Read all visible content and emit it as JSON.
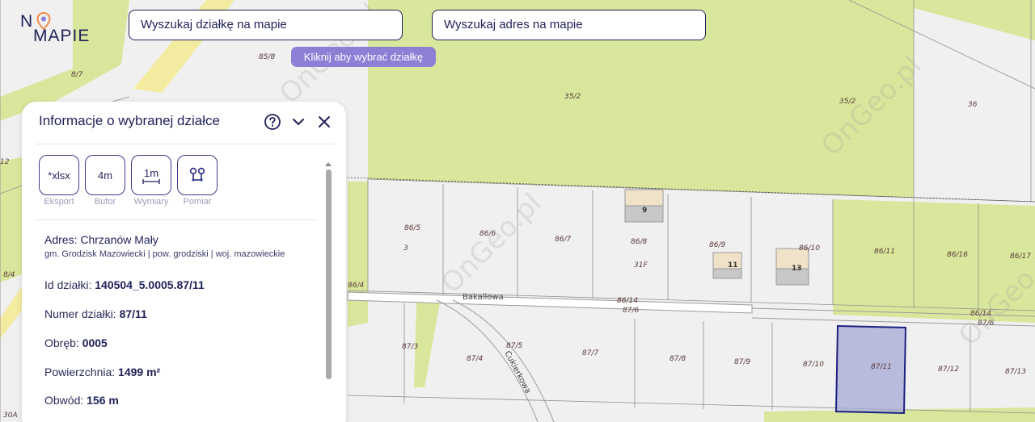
{
  "logo": {
    "line1": "N",
    "line1b": "",
    "line2": "MAPIE"
  },
  "search": {
    "parcel_label": "Wyszukaj działkę na mapie",
    "address_label": "Wyszukaj adres na mapie"
  },
  "tooltip": "Kliknij aby wybrać działkę",
  "panel": {
    "title": "Informacje o wybranej działce",
    "tools": [
      {
        "text": "*xlsx",
        "label": "Eksport"
      },
      {
        "text": "4m",
        "label": "Bufor"
      },
      {
        "text": "1m",
        "label": "Wymiary"
      },
      {
        "text": "",
        "label": "Pomiar"
      }
    ],
    "address": "Adres: Chrzanów Mały",
    "address_sub": "gm. Grodzisk Mazowiecki | pow. grodziski | woj. mazowieckie",
    "rows": [
      {
        "label": "Id działki: ",
        "value": "140504_5.0005.87/11"
      },
      {
        "label": "Numer działki: ",
        "value": "87/11"
      },
      {
        "label": "Obręb: ",
        "value": "0005"
      },
      {
        "label": "Powierzchnia: ",
        "value": "1499 m²"
      },
      {
        "label": "Obwód: ",
        "value": "156 m"
      }
    ]
  },
  "map": {
    "watermark": "OnGeo.pl",
    "streets": [
      "Bakaliowa",
      "Cukierkowa"
    ],
    "parcels": [
      "85/8",
      "8/7",
      "35/2",
      "35/2",
      "36",
      "12",
      "86/5",
      "86/6",
      "86/7",
      "86/8",
      "86/9",
      "86/10",
      "86/11",
      "86/16",
      "86/17",
      "3",
      "31F",
      "8/4",
      "86/4",
      "86/14",
      "87/6",
      "86/14",
      "87/6",
      "87/3",
      "87/4",
      "87/5",
      "87/7",
      "87/8",
      "87/9",
      "87/10",
      "87/11",
      "87/12",
      "87/13",
      "30A"
    ],
    "buildings": [
      "9",
      "11",
      "13"
    ],
    "colors": {
      "green": "#d9e79c",
      "selected_fill": "#a7a9d6",
      "selected_stroke": "#1f2180"
    }
  }
}
